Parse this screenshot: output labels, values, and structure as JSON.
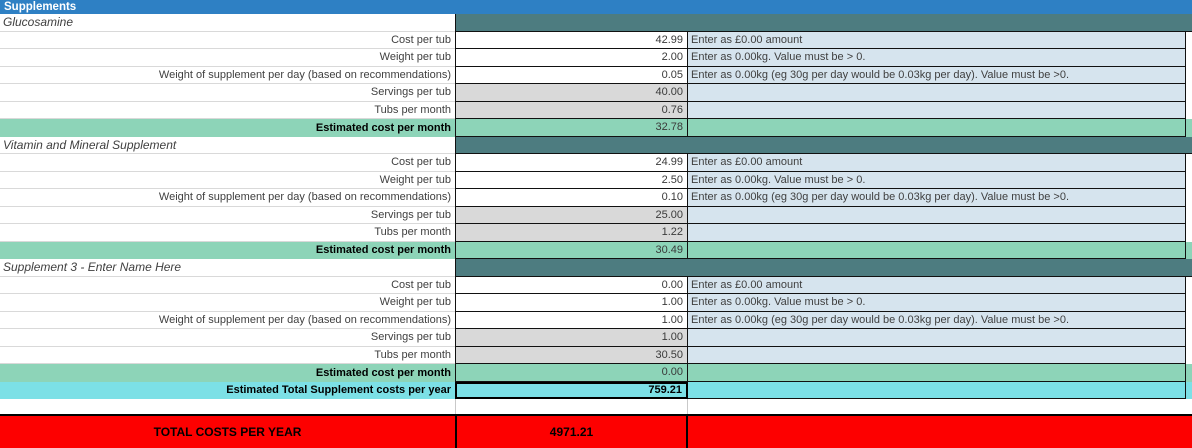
{
  "sheet_title": "Supplements",
  "labels": [
    "Cost per tub",
    "Weight per tub",
    "Weight of supplement per day (based on recommendations)",
    "Servings per tub",
    "Tubs per month",
    "Estimated cost per month"
  ],
  "hints": [
    "Enter as £0.00 amount",
    "Enter as 0.00kg. Value must be > 0.",
    "Enter as 0.00kg (eg 30g per day would be 0.03kg per day). Value must be >0."
  ],
  "sections": [
    {
      "name": "Glucosamine",
      "values": [
        "42.99",
        "2.00",
        "0.05",
        "40.00",
        "0.76",
        "32.78"
      ]
    },
    {
      "name": "Vitamin and Mineral Supplement",
      "values": [
        "24.99",
        "2.50",
        "0.10",
        "25.00",
        "1.22",
        "30.49"
      ]
    },
    {
      "name": "Supplement 3 - Enter Name Here",
      "values": [
        "0.00",
        "1.00",
        "1.00",
        "1.00",
        "30.50",
        "0.00"
      ]
    }
  ],
  "summary": {
    "total_supplements_label": "Estimated Total Supplement costs per year",
    "total_supplements_value": "759.21"
  },
  "grand_total": {
    "label": "TOTAL COSTS PER YEAR",
    "value": "4971.21"
  },
  "colors": {
    "header_blue": "#2E80C4",
    "section_teal": "#4D7C80",
    "estimate_green": "#8DD4B8",
    "total_cyan": "#7CE0E6",
    "hint_blue": "#D6E4EE",
    "computed_gray": "#D9D9D9",
    "total_red": "#FD0000"
  }
}
